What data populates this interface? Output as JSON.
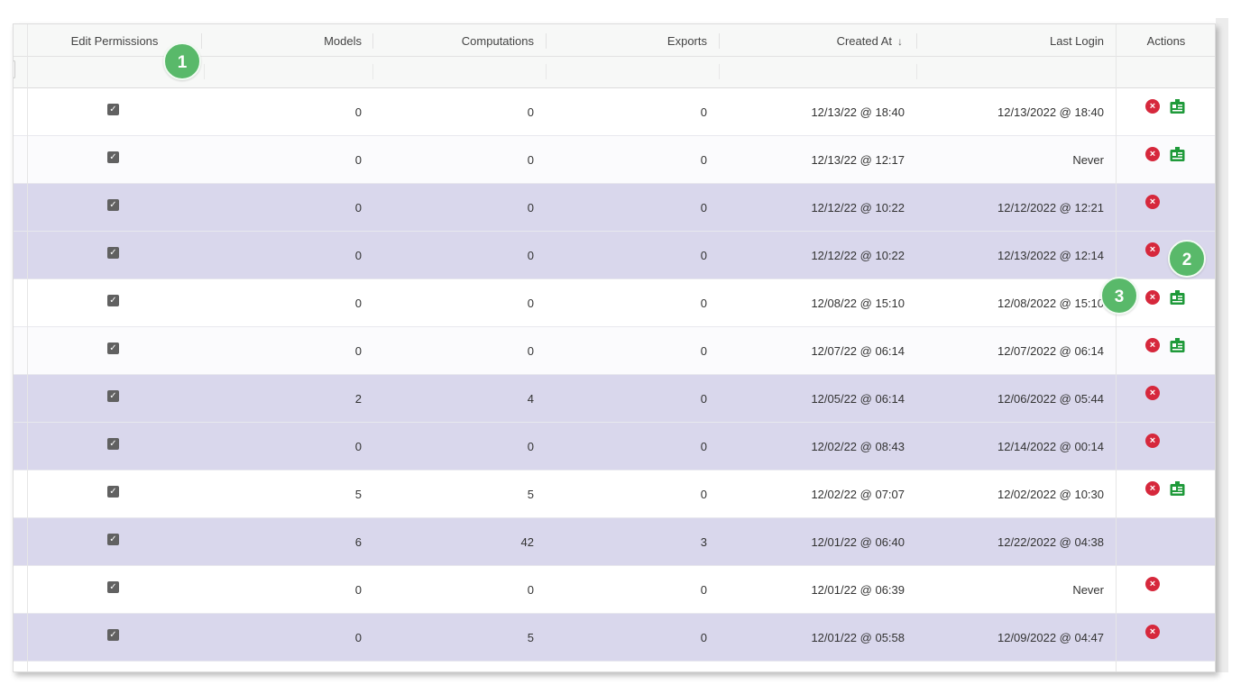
{
  "columns": {
    "edit_permissions": "Edit Permissions",
    "models": "Models",
    "computations": "Computations",
    "exports": "Exports",
    "created_at": "Created At",
    "created_at_sort": "↓",
    "last_login": "Last Login",
    "actions": "Actions"
  },
  "rows": [
    {
      "models": "0",
      "computations": "0",
      "exports": "0",
      "created": "12/13/22 @ 18:40",
      "last_login": "12/13/2022 @ 18:40",
      "edit_checked": true,
      "has_badge": true,
      "has_delete": true,
      "highlight": false
    },
    {
      "models": "0",
      "computations": "0",
      "exports": "0",
      "created": "12/13/22 @ 12:17",
      "last_login": "Never",
      "edit_checked": true,
      "has_badge": true,
      "has_delete": true,
      "highlight": false
    },
    {
      "models": "0",
      "computations": "0",
      "exports": "0",
      "created": "12/12/22 @ 10:22",
      "last_login": "12/12/2022 @ 12:21",
      "edit_checked": true,
      "has_badge": false,
      "has_delete": true,
      "highlight": true
    },
    {
      "models": "0",
      "computations": "0",
      "exports": "0",
      "created": "12/12/22 @ 10:22",
      "last_login": "12/13/2022 @ 12:14",
      "edit_checked": true,
      "has_badge": false,
      "has_delete": true,
      "highlight": true
    },
    {
      "models": "0",
      "computations": "0",
      "exports": "0",
      "created": "12/08/22 @ 15:10",
      "last_login": "12/08/2022 @ 15:10",
      "edit_checked": true,
      "has_badge": true,
      "has_delete": true,
      "highlight": false
    },
    {
      "models": "0",
      "computations": "0",
      "exports": "0",
      "created": "12/07/22 @ 06:14",
      "last_login": "12/07/2022 @ 06:14",
      "edit_checked": true,
      "has_badge": true,
      "has_delete": true,
      "highlight": false
    },
    {
      "models": "2",
      "computations": "4",
      "exports": "0",
      "created": "12/05/22 @ 06:14",
      "last_login": "12/06/2022 @ 05:44",
      "edit_checked": true,
      "has_badge": false,
      "has_delete": true,
      "highlight": true
    },
    {
      "models": "0",
      "computations": "0",
      "exports": "0",
      "created": "12/02/22 @ 08:43",
      "last_login": "12/14/2022 @ 00:14",
      "edit_checked": true,
      "has_badge": false,
      "has_delete": true,
      "highlight": true
    },
    {
      "models": "5",
      "computations": "5",
      "exports": "0",
      "created": "12/02/22 @ 07:07",
      "last_login": "12/02/2022 @ 10:30",
      "edit_checked": true,
      "has_badge": true,
      "has_delete": true,
      "highlight": false
    },
    {
      "models": "6",
      "computations": "42",
      "exports": "3",
      "created": "12/01/22 @ 06:40",
      "last_login": "12/22/2022 @ 04:38",
      "edit_checked": true,
      "has_badge": false,
      "has_delete": false,
      "highlight": true
    },
    {
      "models": "0",
      "computations": "0",
      "exports": "0",
      "created": "12/01/22 @ 06:39",
      "last_login": "Never",
      "edit_checked": true,
      "has_badge": false,
      "has_delete": true,
      "highlight": false
    },
    {
      "models": "0",
      "computations": "5",
      "exports": "0",
      "created": "12/01/22 @ 05:58",
      "last_login": "12/09/2022 @ 04:47",
      "edit_checked": true,
      "has_badge": false,
      "has_delete": true,
      "highlight": true
    }
  ],
  "callouts": [
    "1",
    "2",
    "3"
  ],
  "icons": {
    "delete": "delete-icon",
    "badge": "id-badge-icon",
    "checkbox": "checkbox-checked-icon"
  },
  "colors": {
    "selected_row": "#d9d7ec",
    "delete": "#d6283c",
    "badge": "#1f9a3a",
    "callout": "#59b96a"
  }
}
